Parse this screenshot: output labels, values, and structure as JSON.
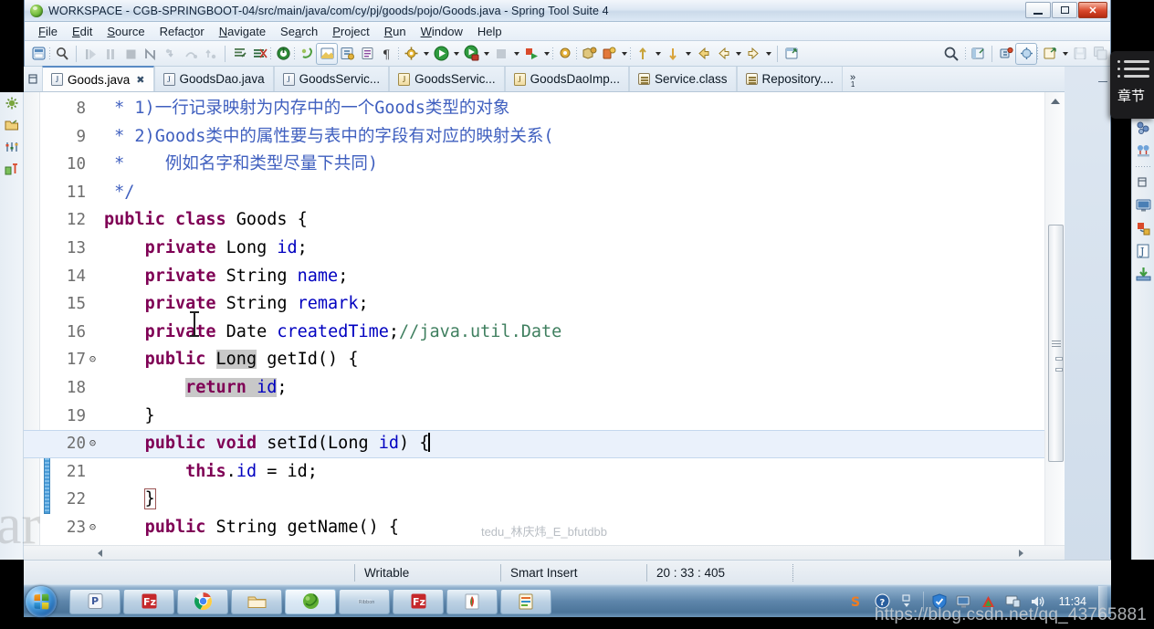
{
  "window": {
    "title": "WORKSPACE - CGB-SPRINGBOOT-04/src/main/java/com/cy/pj/goods/pojo/Goods.java - Spring Tool Suite 4",
    "app_icon": "spring-leaf-icon",
    "minimize_label": "Minimize",
    "restore_label": "Restore",
    "close_label": "✕"
  },
  "menubar": {
    "items": [
      {
        "label": "File",
        "mnemonic": "F"
      },
      {
        "label": "Edit",
        "mnemonic": "E"
      },
      {
        "label": "Source",
        "mnemonic": "S"
      },
      {
        "label": "Refactor",
        "mnemonic": "t"
      },
      {
        "label": "Navigate",
        "mnemonic": "N"
      },
      {
        "label": "Search",
        "mnemonic": "a"
      },
      {
        "label": "Project",
        "mnemonic": "P"
      },
      {
        "label": "Run",
        "mnemonic": "R"
      },
      {
        "label": "Window",
        "mnemonic": "W"
      },
      {
        "label": "Help",
        "mnemonic": "H"
      }
    ]
  },
  "toolbar": {
    "icons": [
      "new-wizard-icon",
      "inspect-icon",
      "resume-icon",
      "suspend-icon",
      "terminate-icon",
      "step-into-icon",
      "step-over-icon",
      "step-return-icon",
      "drop-to-frame-icon",
      "show-console-icon",
      "remove-all-breakpoints-icon",
      "boot-dashboard-icon",
      "new-spring-starter-icon",
      "open-editor-icon",
      "debug-icon",
      "validate-icon",
      "paragraph-icon",
      "external-tools-icon",
      "run-icon",
      "debug-run-icon",
      "coverage-icon",
      "run-last-icon",
      "open-type-icon",
      "new-java-project-icon",
      "new-java-class-icon",
      "new-package-icon",
      "back-icon",
      "forward-icon",
      "next-annotation-icon",
      "previous-annotation-icon",
      "last-edit-location-icon",
      "search-icon",
      "open-perspective-icon",
      "java-perspective-icon",
      "java-ee-perspective-icon",
      "new-window-icon",
      "save-icon",
      "save-all-icon"
    ]
  },
  "tabs": {
    "items": [
      {
        "label": "Goods.java",
        "icon": "java-file-icon",
        "active": true,
        "dirty_marker": "✖"
      },
      {
        "label": "GoodsDao.java",
        "icon": "java-file-icon",
        "active": false
      },
      {
        "label": "GoodsServic...",
        "icon": "java-file-icon",
        "active": false
      },
      {
        "label": "GoodsServic...",
        "icon": "java-file-gold-icon",
        "active": false
      },
      {
        "label": "GoodsDaoImp...",
        "icon": "java-file-gold-icon",
        "active": false
      },
      {
        "label": "Service.class",
        "icon": "class-file-icon",
        "active": false
      },
      {
        "label": "Repository....",
        "icon": "class-file-icon",
        "active": false
      }
    ],
    "overflow_marker": "»",
    "overflow_count": "1"
  },
  "editor": {
    "watermark": "tedu_林庆炜_E_bfutdbb",
    "current_line": 20,
    "lines": [
      {
        "number": "8",
        "fold": false,
        "tokens": [
          {
            "t": "plain",
            "v": " "
          },
          {
            "t": "comment",
            "v": "* 1)一行记录映射为内存中的一个Goods类型的对象"
          }
        ]
      },
      {
        "number": "9",
        "fold": false,
        "tokens": [
          {
            "t": "plain",
            "v": " "
          },
          {
            "t": "comment",
            "v": "* 2)Goods类中的属性要与表中的字段有对应的映射关系("
          }
        ]
      },
      {
        "number": "10",
        "fold": false,
        "tokens": [
          {
            "t": "plain",
            "v": " "
          },
          {
            "t": "comment",
            "v": "*    例如名字和类型尽量下共同)"
          }
        ]
      },
      {
        "number": "11",
        "fold": false,
        "tokens": [
          {
            "t": "plain",
            "v": " "
          },
          {
            "t": "comment",
            "v": "*/"
          }
        ]
      },
      {
        "number": "12",
        "fold": false,
        "tokens": [
          {
            "t": "keyword",
            "v": "public class "
          },
          {
            "t": "plain",
            "v": "Goods {"
          }
        ]
      },
      {
        "number": "13",
        "fold": false,
        "tokens": [
          {
            "t": "plain",
            "v": "    "
          },
          {
            "t": "keyword",
            "v": "private "
          },
          {
            "t": "plain",
            "v": "Long "
          },
          {
            "t": "field",
            "v": "id"
          },
          {
            "t": "plain",
            "v": ";"
          }
        ]
      },
      {
        "number": "14",
        "fold": false,
        "tokens": [
          {
            "t": "plain",
            "v": "    "
          },
          {
            "t": "keyword",
            "v": "private "
          },
          {
            "t": "plain",
            "v": "String "
          },
          {
            "t": "field",
            "v": "name"
          },
          {
            "t": "plain",
            "v": ";"
          }
        ]
      },
      {
        "number": "15",
        "fold": false,
        "tokens": [
          {
            "t": "plain",
            "v": "    "
          },
          {
            "t": "keyword",
            "v": "private "
          },
          {
            "t": "plain",
            "v": "String "
          },
          {
            "t": "field",
            "v": "remark"
          },
          {
            "t": "plain",
            "v": ";"
          }
        ]
      },
      {
        "number": "16",
        "fold": false,
        "tokens": [
          {
            "t": "plain",
            "v": "    "
          },
          {
            "t": "keyword",
            "v": "private "
          },
          {
            "t": "plain",
            "v": "Date "
          },
          {
            "t": "field",
            "v": "createdTime"
          },
          {
            "t": "plain",
            "v": ";"
          },
          {
            "t": "linecomment",
            "v": "//java.util.Date"
          }
        ]
      },
      {
        "number": "17",
        "fold": true,
        "tokens": [
          {
            "t": "plain",
            "v": "    "
          },
          {
            "t": "keyword",
            "v": "public "
          },
          {
            "t": "highlight",
            "v": "Long"
          },
          {
            "t": "plain",
            "v": " getId() {"
          }
        ]
      },
      {
        "number": "18",
        "fold": false,
        "tokens": [
          {
            "t": "plain",
            "v": "        "
          },
          {
            "t": "keyword-hl",
            "v": "return "
          },
          {
            "t": "field-hl",
            "v": "id"
          },
          {
            "t": "plain",
            "v": ";"
          }
        ]
      },
      {
        "number": "19",
        "fold": false,
        "tokens": [
          {
            "t": "plain",
            "v": "    }"
          }
        ]
      },
      {
        "number": "20",
        "fold": true,
        "tokens": [
          {
            "t": "plain",
            "v": "    "
          },
          {
            "t": "keyword",
            "v": "public void "
          },
          {
            "t": "plain",
            "v": "setId(Long "
          },
          {
            "t": "field",
            "v": "id"
          },
          {
            "t": "plain",
            "v": ") {"
          },
          {
            "t": "caret",
            "v": ""
          }
        ]
      },
      {
        "number": "21",
        "fold": false,
        "tokens": [
          {
            "t": "plain",
            "v": "        "
          },
          {
            "t": "keyword",
            "v": "this"
          },
          {
            "t": "plain",
            "v": "."
          },
          {
            "t": "field",
            "v": "id"
          },
          {
            "t": "plain",
            "v": " = id;"
          }
        ]
      },
      {
        "number": "22",
        "fold": false,
        "tokens": [
          {
            "t": "plain",
            "v": "    "
          },
          {
            "t": "bracket",
            "v": "}"
          }
        ]
      },
      {
        "number": "23",
        "fold": true,
        "tokens": [
          {
            "t": "plain",
            "v": "    "
          },
          {
            "t": "keyword",
            "v": "public "
          },
          {
            "t": "plain",
            "v": "String getName() {"
          }
        ]
      }
    ]
  },
  "statusbar": {
    "writable": "Writable",
    "insert_mode": "Smart Insert",
    "position": "20 : 33 : 405"
  },
  "right_toolstrip": {
    "icons": [
      "variables-icon",
      "outline-icon",
      "breakpoints-icon",
      "separator-dots",
      "tasks-icon",
      "console-icon",
      "progress-icon",
      "javadoc-icon",
      "install-icon"
    ]
  },
  "left_toolstrip": {
    "icons": [
      "spring-boot-dashboard-icon",
      "package-explorer-icon",
      "boot-properties-icon",
      "junit-icon"
    ]
  },
  "chapters_overlay": {
    "icon": "list-menu-icon",
    "label": "章节"
  },
  "taskbar": {
    "start_label": "Start",
    "items": [
      {
        "name": "powerpoint-icon"
      },
      {
        "name": "filezilla-icon"
      },
      {
        "name": "chrome-icon"
      },
      {
        "name": "explorer-icon"
      },
      {
        "name": "spring-tool-suite-icon",
        "active": true
      },
      {
        "name": "unknown-app-icon"
      },
      {
        "name": "filezilla-2-icon"
      },
      {
        "name": "pdf-reader-icon"
      },
      {
        "name": "notes-app-icon"
      }
    ],
    "tray": [
      "sogou-input-icon",
      "help-icon",
      "expand-tray-icon",
      "security-shield-icon",
      "network-monitor-icon",
      "driver-icon",
      "display-icon",
      "volume-icon"
    ],
    "clock": "11:34"
  },
  "watermarks": {
    "csdn": "https://blog.csdn.net/qq_43765881"
  },
  "colors": {
    "keyword": "#7f0055",
    "comment": "#3f5fbf",
    "line_comment": "#3f7f5f",
    "field": "#0000c0",
    "current_line_bg": "#eaf1fb",
    "selection": "#c8c8c8",
    "titlebar": "#dce8f5",
    "taskbar": "#5e86ab"
  }
}
